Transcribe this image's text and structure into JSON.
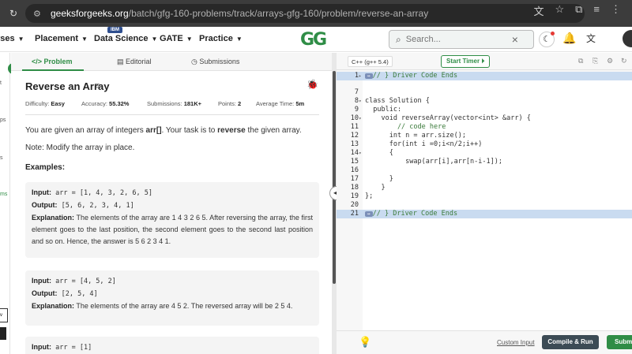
{
  "browser": {
    "url_host": "geeksforgeeks.org",
    "url_path": "/batch/gfg-160-problems/track/arrays-gfg-160/problem/reverse-an-array"
  },
  "nav": {
    "items": [
      "rses",
      "Placement",
      "Data Science",
      "GATE",
      "Practice"
    ],
    "ibm_badge": "IBM",
    "logo": "GG",
    "search_placeholder": "Search..."
  },
  "sidebar": {
    "labels": [
      "t",
      "ps",
      "s",
      "ms"
    ],
    "box_label": "v"
  },
  "tabs": [
    "Problem",
    "Editorial",
    "Submissions"
  ],
  "problem": {
    "title": "Reverse an Array",
    "meta": {
      "difficulty_label": "Difficulty:",
      "difficulty": "Easy",
      "accuracy_label": "Accuracy:",
      "accuracy": "55.32%",
      "submissions_label": "Submissions:",
      "submissions": "181K+",
      "points_label": "Points:",
      "points": "2",
      "avg_time_label": "Average Time:",
      "avg_time": "5m"
    },
    "desc_pre": "You are given an array of integers ",
    "desc_arr": "arr[]",
    "desc_mid": ". Your task is to ",
    "desc_rev": "reverse",
    "desc_post": " the given array.",
    "note": "Note: Modify the array in place.",
    "examples_heading": "Examples:",
    "examples": [
      {
        "input_label": "Input:",
        "input": "arr = [1, 4, 3, 2, 6, 5]",
        "output_label": "Output:",
        "output": "[5, 6, 2, 3, 4, 1]",
        "explanation_label": "Explanation:",
        "explanation": "The elements of the array are 1 4 3 2 6 5. After reversing the array, the first element goes to the last position, the second element goes to the second last position and so on. Hence, the answer is 5 6 2 3 4 1."
      },
      {
        "input_label": "Input:",
        "input": "arr = [4, 5, 2]",
        "output_label": "Output:",
        "output": "[2, 5, 4]",
        "explanation_label": "Explanation:",
        "explanation": "The elements of the array are 4 5 2. The reversed array will be 2 5 4."
      },
      {
        "input_label": "Input:",
        "input": "arr = [1]"
      }
    ]
  },
  "editor": {
    "language": "C++ (g++ 5.4)",
    "timer_label": "Start Timer",
    "lines": [
      {
        "n": "1",
        "fold": "▸",
        "text": "// } Driver Code Ends",
        "hl": true,
        "folded": true
      },
      {
        "n": "7",
        "fold": "",
        "text": ""
      },
      {
        "n": "8",
        "fold": "▾",
        "text": "class Solution {"
      },
      {
        "n": "9",
        "fold": "",
        "text": "  public:"
      },
      {
        "n": "10",
        "fold": "▾",
        "text": "    void reverseArray(vector<int> &arr) {"
      },
      {
        "n": "11",
        "fold": "",
        "text": "        // code here"
      },
      {
        "n": "12",
        "fold": "",
        "text": "      int n = arr.size();"
      },
      {
        "n": "13",
        "fold": "",
        "text": "      for(int i =0;i<n/2;i++)"
      },
      {
        "n": "14",
        "fold": "▾",
        "text": "      {"
      },
      {
        "n": "15",
        "fold": "",
        "text": "          swap(arr[i],arr[n-i-1]);"
      },
      {
        "n": "16",
        "fold": "",
        "text": ""
      },
      {
        "n": "17",
        "fold": "",
        "text": "      }"
      },
      {
        "n": "18",
        "fold": "",
        "text": "    }"
      },
      {
        "n": "19",
        "fold": "",
        "text": "};"
      },
      {
        "n": "20",
        "fold": "",
        "text": ""
      },
      {
        "n": "21",
        "fold": "",
        "text": "// } Driver Code Ends",
        "hl": true,
        "folded": true
      }
    ],
    "custom_input": "Custom Input",
    "compile_run": "Compile & Run",
    "submit": "Submit"
  }
}
